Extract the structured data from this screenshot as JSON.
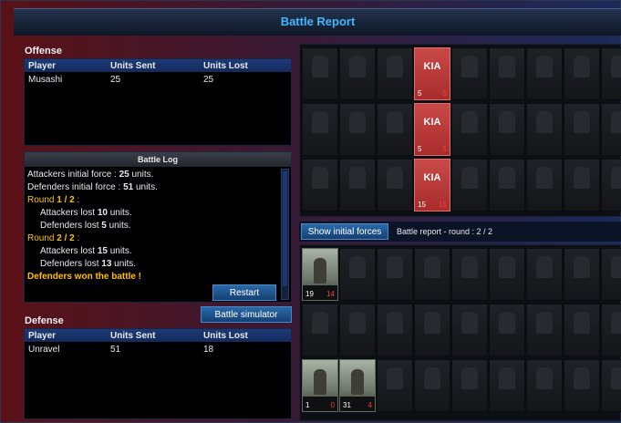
{
  "window": {
    "title": "Battle Report"
  },
  "offense": {
    "heading": "Offense",
    "columns": [
      "Player",
      "Units Sent",
      "Units Lost"
    ],
    "rows": [
      {
        "player": "Musashi",
        "sent": "25",
        "lost": "25"
      }
    ]
  },
  "battle_log": {
    "heading": "Battle Log",
    "lines": {
      "att_prefix": "Attackers initial force : ",
      "att_value": "25",
      "att_suffix": " units.",
      "def_prefix": "Defenders initial force : ",
      "def_value": "51",
      "def_suffix": " units.",
      "r1_label": "Round ",
      "r1_value": "1 / 2",
      "r1_suffix": " :",
      "r1_att_prefix": "Attackers lost ",
      "r1_att_value": "10",
      "r1_att_suffix": " units.",
      "r1_def_prefix": "Defenders lost ",
      "r1_def_value": "5",
      "r1_def_suffix": " units.",
      "r2_label": "Round ",
      "r2_value": "2 / 2",
      "r2_suffix": " :",
      "r2_att_prefix": "Attackers lost ",
      "r2_att_value": "15",
      "r2_att_suffix": " units.",
      "r2_def_prefix": "Defenders lost ",
      "r2_def_value": "13",
      "r2_def_suffix": " units.",
      "result": "Defenders won the battle !"
    },
    "restart_label": "Restart"
  },
  "simulator_label": "Battle simulator",
  "defense": {
    "heading": "Defense",
    "columns": [
      "Player",
      "Units Sent",
      "Units Lost"
    ],
    "rows": [
      {
        "player": "Unravel",
        "sent": "51",
        "lost": "18"
      }
    ]
  },
  "attacker_grid": {
    "kia_label": "KIA",
    "kia_tiles": [
      {
        "sent": "5",
        "lost": "5"
      },
      {
        "sent": "5",
        "lost": "5"
      },
      {
        "sent": "15",
        "lost": "15"
      }
    ]
  },
  "round_bar": {
    "button_label": "Show initial forces",
    "info": "Battle report - round : 2 / 2"
  },
  "defender_grid": {
    "unit_tiles": [
      {
        "sent": "19",
        "lost": "14"
      },
      {
        "sent": "1",
        "lost": "0"
      },
      {
        "sent": "31",
        "lost": "4"
      }
    ]
  },
  "colors": {
    "accent": "#3fb8ff",
    "highlight": "#ffc000",
    "loss": "#ff3b3b",
    "kia": "#c84a48"
  }
}
